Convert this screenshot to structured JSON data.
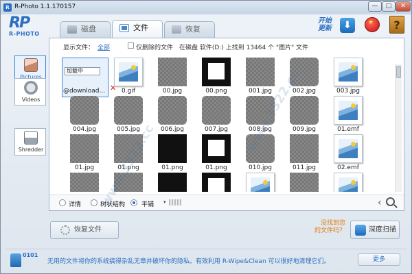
{
  "window": {
    "title": "R-Photo 1.1.170157",
    "logo_text": "RP",
    "logo_sub": "R-PHOTO",
    "controls": {
      "min": "—",
      "max": "□",
      "close": "✕"
    }
  },
  "tabs": [
    {
      "label": "磁盘",
      "icon": "disk-icon"
    },
    {
      "label": "文件",
      "icon": "file-icon",
      "active": true
    },
    {
      "label": "恢复",
      "icon": "restore-icon"
    }
  ],
  "topright": {
    "update_line1": "开始",
    "update_line2": "更新",
    "download_glyph": "⬇",
    "help_glyph": "?"
  },
  "filter": {
    "show_label": "显示文件：",
    "show_value": "全部",
    "deleted_only_label": "仅删除的文件",
    "found_text": "在磁盘 软件(D:) 上找到 13464 个 \"图片\" 文件"
  },
  "sidebar": {
    "items": [
      {
        "label": "Pictures",
        "icon": "picture-icon",
        "active": true
      },
      {
        "label": "Videos",
        "icon": "video-icon"
      },
      {
        "label": "Shredder",
        "icon": "shredder-icon"
      }
    ]
  },
  "files": {
    "loading_label": "加载中",
    "deleted_mark": "✕",
    "items": [
      {
        "name": "@download...",
        "kind": "selected"
      },
      {
        "name": "0.gif",
        "kind": "photo"
      },
      {
        "name": "00.jpg",
        "kind": "checker"
      },
      {
        "name": "00.png",
        "kind": "blackwhite"
      },
      {
        "name": "001.jpg",
        "kind": "checker"
      },
      {
        "name": "002.jpg",
        "kind": "gear"
      },
      {
        "name": "003.jpg",
        "kind": "photo"
      },
      {
        "name": "004.jpg",
        "kind": "gear"
      },
      {
        "name": "005.jpg",
        "kind": "gear"
      },
      {
        "name": "006.jpg",
        "kind": "gear"
      },
      {
        "name": "007.jpg",
        "kind": "gear"
      },
      {
        "name": "008.jpg",
        "kind": "gear"
      },
      {
        "name": "009.jpg",
        "kind": "gear"
      },
      {
        "name": "01.emf",
        "kind": "photo"
      },
      {
        "name": "01.jpg",
        "kind": "checker"
      },
      {
        "name": "01.png",
        "kind": "checker"
      },
      {
        "name": "01.png",
        "kind": "black"
      },
      {
        "name": "01.png",
        "kind": "blackwhite"
      },
      {
        "name": "010.jpg",
        "kind": "gear"
      },
      {
        "name": "011.jpg",
        "kind": "checker"
      },
      {
        "name": "02.emf",
        "kind": "photo"
      },
      {
        "name": "",
        "kind": "checker"
      },
      {
        "name": "",
        "kind": "checker"
      },
      {
        "name": "",
        "kind": "black"
      },
      {
        "name": "",
        "kind": "blackwhite"
      },
      {
        "name": "",
        "kind": "photo"
      },
      {
        "name": "",
        "kind": "checker"
      },
      {
        "name": "",
        "kind": "photo"
      }
    ]
  },
  "viewbar": {
    "detail": "详情",
    "tree": "树状结构",
    "tile": "平铺",
    "caret": "▾",
    "nav": "‹"
  },
  "bottom": {
    "restore_label": "恢复文件",
    "not_found_line1": "没找到您",
    "not_found_line2": "的文件吗？",
    "deep_scan_label": "深度扫描"
  },
  "ad": {
    "icon_text": "0101",
    "text": "无用的文件将你的系统搞得杂乱无章并破坏你的隐私。有效利用 R-Wipe&Clean 可以很好地清理它们。",
    "more_label": "更多"
  },
  "watermark": {
    "text": "www.3322.cc"
  }
}
